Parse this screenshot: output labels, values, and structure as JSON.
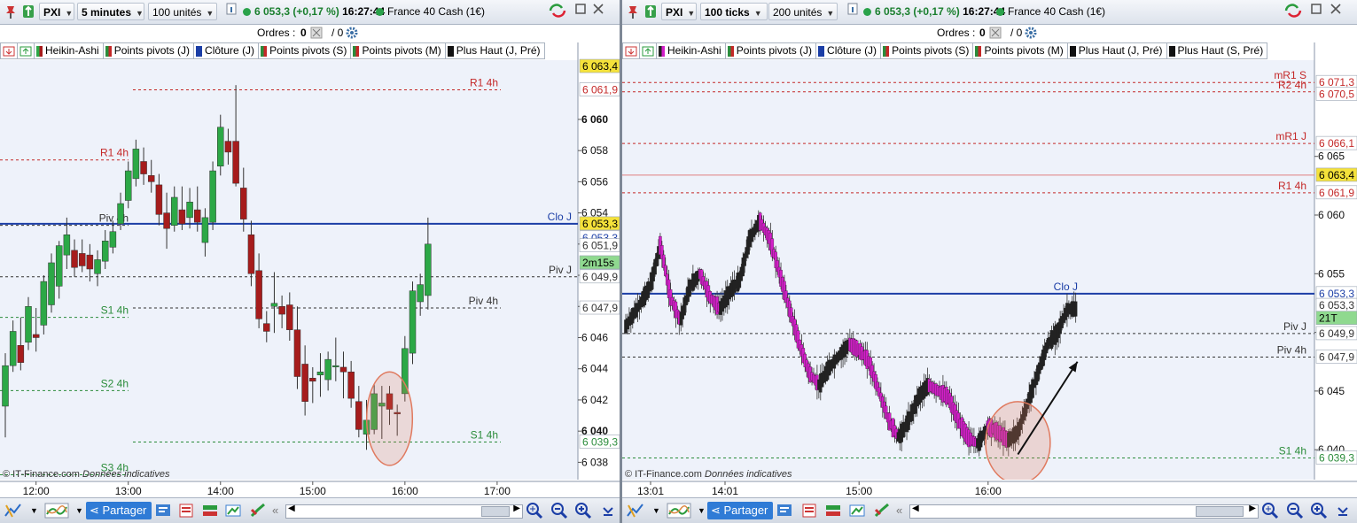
{
  "colors": {
    "bull": "#2ca846",
    "bear": "#a61c1c",
    "tick_up": "#222222",
    "tick_down": "#d21fc8",
    "clo_line": "#1b3ea6",
    "resistance": "#c42828",
    "support": "#2b8c3b",
    "pivot": "#333333",
    "highlight_ellipse": "#e07a5f"
  },
  "left": {
    "toolbar": {
      "ticker": "PXI",
      "interval": "5 minutes",
      "units": "100 unités",
      "price": "6 053,3",
      "change": "(+0,17 %)",
      "time": "16:27:44",
      "instrument": "France 40 Cash (1€)"
    },
    "orders": {
      "label": "Ordres :",
      "count": "0",
      "slash": "/ 0"
    },
    "indicators": [
      "Heikin-Ashi",
      "Points pivots (J)",
      "Clôture (J)",
      "Points pivots (S)",
      "Points pivots (M)",
      "Plus Haut (J, Pré)"
    ],
    "footer_note": "© IT-Finance.com",
    "footer_note2": "Données indicatives",
    "bottom": {
      "share": "Partager"
    },
    "chart_data": {
      "type": "candlestick",
      "title": "PXI France 40 Cash (1€) — 5 minutes, Heikin-Ashi",
      "y_ticks": [
        6038,
        6040,
        6042,
        6044,
        6046,
        6048,
        6050,
        6052,
        6054,
        6056,
        6058,
        6060
      ],
      "y_tick_labels": [
        "6 038",
        "6 040",
        "6 042",
        "6 044",
        "6 046",
        "6 048",
        "6 050",
        "6 052",
        "6 054",
        "6 056",
        "6 058",
        "6 060"
      ],
      "ylim": [
        6037,
        6063.8
      ],
      "x_ticks": [
        {
          "label": "12:00",
          "index": 4
        },
        {
          "label": "13:00",
          "index": 16
        },
        {
          "label": "14:00",
          "index": 28
        },
        {
          "label": "15:00",
          "index": 40
        },
        {
          "label": "16:00",
          "index": 52
        },
        {
          "label": "17:00",
          "index": 64
        }
      ],
      "candles": [
        [
          6041.6,
          6045.0,
          6039.6,
          6044.2
        ],
        [
          6044.2,
          6047.1,
          6043.8,
          6046.4
        ],
        [
          6045.5,
          6047.3,
          6043.9,
          6044.4
        ],
        [
          6045.7,
          6048.6,
          6045.2,
          6048.0
        ],
        [
          6046.2,
          6047.9,
          6045.1,
          6046.0
        ],
        [
          6046.8,
          6050.0,
          6046.2,
          6049.6
        ],
        [
          6048.1,
          6051.4,
          6047.6,
          6050.8
        ],
        [
          6049.3,
          6052.2,
          6048.5,
          6051.9
        ],
        [
          6051.3,
          6053.7,
          6050.4,
          6052.6
        ],
        [
          6051.6,
          6052.3,
          6049.9,
          6050.5
        ],
        [
          6051.4,
          6052.3,
          6050.2,
          6050.6
        ],
        [
          6051.3,
          6052.0,
          6049.6,
          6050.4
        ],
        [
          6050.1,
          6051.6,
          6049.3,
          6051.0
        ],
        [
          6050.9,
          6052.9,
          6050.4,
          6052.2
        ],
        [
          6051.8,
          6053.5,
          6051.4,
          6052.8
        ],
        [
          6053.3,
          6055.3,
          6052.9,
          6054.6
        ],
        [
          6054.8,
          6057.3,
          6054.3,
          6056.7
        ],
        [
          6056.2,
          6058.7,
          6055.7,
          6058.1
        ],
        [
          6057.3,
          6058.2,
          6055.8,
          6056.5
        ],
        [
          6056.4,
          6057.4,
          6055.3,
          6056.0
        ],
        [
          6055.8,
          6056.5,
          6053.2,
          6053.9
        ],
        [
          6054.0,
          6055.3,
          6051.7,
          6053.0
        ],
        [
          6053.2,
          6055.7,
          6052.8,
          6055.0
        ],
        [
          6054.2,
          6055.7,
          6052.9,
          6053.3
        ],
        [
          6053.7,
          6055.6,
          6053.0,
          6054.7
        ],
        [
          6054.2,
          6055.7,
          6052.8,
          6053.4
        ],
        [
          6052.1,
          6054.3,
          6051.2,
          6053.7
        ],
        [
          6053.4,
          6057.3,
          6052.9,
          6056.7
        ],
        [
          6057.0,
          6060.3,
          6056.4,
          6059.5
        ],
        [
          6058.6,
          6059.4,
          6057.1,
          6057.9
        ],
        [
          6058.6,
          6062.2,
          6055.7,
          6055.9
        ],
        [
          6055.6,
          6056.9,
          6052.8,
          6053.6
        ],
        [
          6052.6,
          6053.5,
          6049.3,
          6050.1
        ],
        [
          6050.3,
          6051.4,
          6046.6,
          6047.2
        ],
        [
          6046.9,
          6047.7,
          6045.7,
          6046.4
        ],
        [
          6048.0,
          6050.2,
          6046.3,
          6048.2
        ],
        [
          6048.0,
          6048.7,
          6046.6,
          6047.5
        ],
        [
          6048.1,
          6048.9,
          6045.8,
          6046.5
        ],
        [
          6046.5,
          6048.0,
          6042.7,
          6043.5
        ],
        [
          6044.3,
          6045.5,
          6041.0,
          6041.9
        ],
        [
          6043.4,
          6044.1,
          6041.8,
          6043.2
        ],
        [
          6043.6,
          6045.0,
          6042.2,
          6043.8
        ],
        [
          6043.3,
          6045.1,
          6042.6,
          6044.6
        ],
        [
          6044.2,
          6046.0,
          6043.2,
          6044.2
        ],
        [
          6044.1,
          6045.1,
          6042.1,
          6043.8
        ],
        [
          6043.8,
          6044.5,
          6041.5,
          6042.1
        ],
        [
          6041.9,
          6042.9,
          6039.6,
          6040.1
        ],
        [
          6039.8,
          6042.0,
          6038.8,
          6040.7
        ],
        [
          6040.1,
          6043.0,
          6039.8,
          6042.4
        ],
        [
          6041.6,
          6042.9,
          6039.5,
          6041.8
        ],
        [
          6042.4,
          6042.9,
          6040.4,
          6041.4
        ],
        [
          6041.2,
          6041.7,
          6039.7,
          6041.1
        ],
        [
          6042.4,
          6046.1,
          6041.9,
          6045.3
        ],
        [
          6045.0,
          6049.6,
          6044.3,
          6049.0
        ],
        [
          6048.3,
          6050.1,
          6047.4,
          6049.4
        ],
        [
          6048.7,
          6053.7,
          6047.8,
          6052.0
        ]
      ],
      "hlines": [
        {
          "label": "Clo J",
          "value": 6053.3,
          "kind": "clo"
        },
        {
          "label": "Piv J",
          "value": 6049.9,
          "kind": "pivot"
        },
        {
          "label": "Piv 4h",
          "value": 6047.9,
          "kind": "pivot"
        },
        {
          "label": "R1 4h",
          "value": 6061.9,
          "kind": "resistance"
        },
        {
          "label": "R1 4h",
          "value": 6057.4,
          "kind": "resistance"
        },
        {
          "label": "S1 4h",
          "value": 6047.3,
          "kind": "support"
        },
        {
          "label": "S2 4h",
          "value": 6042.6,
          "kind": "support"
        },
        {
          "label": "S1 4h",
          "value": 6039.3,
          "kind": "support"
        },
        {
          "label": "S3 4h",
          "value": 6037.2,
          "kind": "support"
        },
        {
          "label": "Piv 4h",
          "value": 6053.2,
          "kind": "pivot"
        }
      ],
      "price_labels": [
        {
          "text": "6 063,4",
          "value": 6063.4,
          "bg": "#f5e23a",
          "fg": "#000000"
        },
        {
          "text": "6 061,9",
          "value": 6061.9,
          "bg": "#ffffff",
          "fg": "#c42828"
        },
        {
          "text": "6 053,3",
          "value": 6053.3,
          "bg": "#f5e23a",
          "fg": "#000000"
        },
        {
          "text": "6 053,3",
          "value": 6052.4,
          "bg": "#ffffff",
          "fg": "#1b3ea6"
        },
        {
          "text": "6 051,9",
          "value": 6051.9,
          "bg": "#ffffff",
          "fg": "#333333"
        },
        {
          "text": "2m15s",
          "value": 6050.8,
          "bg": "#8fd98f",
          "fg": "#000000"
        },
        {
          "text": "6 049,9",
          "value": 6049.9,
          "bg": "#ffffff",
          "fg": "#333333"
        },
        {
          "text": "6 047,9",
          "value": 6047.9,
          "bg": "#ffffff",
          "fg": "#333333"
        },
        {
          "text": "6 039,3",
          "value": 6039.3,
          "bg": "#ffffff",
          "fg": "#2b8c3b"
        }
      ],
      "highlight": {
        "center_index": 50,
        "center_value": 6040.8,
        "index_radius": 2.4,
        "value_radius": 3.0
      }
    }
  },
  "right": {
    "toolbar": {
      "ticker": "PXI",
      "interval": "100 ticks",
      "units": "200 unités",
      "price": "6 053,3",
      "change": "(+0,17 %)",
      "time": "16:27:44",
      "instrument": "France 40 Cash (1€)"
    },
    "orders": {
      "label": "Ordres :",
      "count": "0",
      "slash": "/ 0"
    },
    "indicators": [
      "Heikin-Ashi",
      "Points pivots (J)",
      "Clôture (J)",
      "Points pivots (S)",
      "Points pivots (M)",
      "Plus Haut (J, Pré)",
      "Plus Haut (S, Pré)"
    ],
    "footer_note": "© IT-Finance.com",
    "footer_note2": "Données indicatives",
    "bottom": {
      "share": "Partager"
    },
    "chart_data": {
      "type": "candlestick",
      "title": "PXI France 40 Cash (1€) — 100 ticks, Heikin-Ashi",
      "y_ticks": [
        6040,
        6045,
        6050,
        6055,
        6060,
        6065
      ],
      "y_tick_labels": [
        "6 040",
        "6 045",
        "6 050",
        "6 055",
        "6 060",
        "6 065"
      ],
      "ylim": [
        6037.6,
        6073.2
      ],
      "x_ticks": [
        {
          "label": "13:01",
          "index": 5
        },
        {
          "label": "14:01",
          "index": 20
        },
        {
          "label": "15:00",
          "index": 47
        },
        {
          "label": "16:00",
          "index": 73
        }
      ],
      "hlines": [
        {
          "label": "mR1 S",
          "value": 6071.3,
          "kind": "resistance"
        },
        {
          "label": "R2 4h",
          "value": 6070.5,
          "kind": "resistance"
        },
        {
          "label": "mR1 J",
          "value": 6066.1,
          "kind": "resistance"
        },
        {
          "label": "R1 4h",
          "value": 6061.9,
          "kind": "resistance"
        },
        {
          "label": "",
          "value": 6063.4,
          "kind": "high"
        },
        {
          "label": "Clo J",
          "value": 6053.3,
          "kind": "clo"
        },
        {
          "label": "Piv J",
          "value": 6049.9,
          "kind": "pivot"
        },
        {
          "label": "Piv 4h",
          "value": 6047.9,
          "kind": "pivot"
        },
        {
          "label": "S1 4h",
          "value": 6039.3,
          "kind": "support"
        }
      ],
      "price_labels": [
        {
          "text": "6 071,3",
          "value": 6071.3,
          "bg": "#ffffff",
          "fg": "#c42828"
        },
        {
          "text": "6 070,5",
          "value": 6070.3,
          "bg": "#ffffff",
          "fg": "#c42828"
        },
        {
          "text": "6 066,1",
          "value": 6066.1,
          "bg": "#ffffff",
          "fg": "#c42828"
        },
        {
          "text": "6 063,4",
          "value": 6063.4,
          "bg": "#f5e23a",
          "fg": "#000000"
        },
        {
          "text": "6 061,9",
          "value": 6061.9,
          "bg": "#ffffff",
          "fg": "#c42828"
        },
        {
          "text": "6 053,3",
          "value": 6053.3,
          "bg": "#ffffff",
          "fg": "#1b3ea6"
        },
        {
          "text": "6 053,3",
          "value": 6052.3,
          "bg": "#ffffff",
          "fg": "#333333"
        },
        {
          "text": "21T",
          "value": 6051.2,
          "bg": "#8fd98f",
          "fg": "#000000"
        },
        {
          "text": "6 049,9",
          "value": 6049.9,
          "bg": "#ffffff",
          "fg": "#333333"
        },
        {
          "text": "6 047,9",
          "value": 6047.9,
          "bg": "#ffffff",
          "fg": "#333333"
        },
        {
          "text": "6 039,3",
          "value": 6039.3,
          "bg": "#ffffff",
          "fg": "#2b8c3b"
        }
      ],
      "series_path": [
        [
          0,
          6050.5
        ],
        [
          3,
          6052.5
        ],
        [
          5,
          6054
        ],
        [
          7,
          6057.5
        ],
        [
          9,
          6053
        ],
        [
          11,
          6051
        ],
        [
          13,
          6054
        ],
        [
          15,
          6055
        ],
        [
          17,
          6053
        ],
        [
          19,
          6052
        ],
        [
          21,
          6053.5
        ],
        [
          23,
          6054.5
        ],
        [
          25,
          6058
        ],
        [
          27,
          6059.5
        ],
        [
          29,
          6058
        ],
        [
          31,
          6055
        ],
        [
          33,
          6052
        ],
        [
          35,
          6049
        ],
        [
          37,
          6046.5
        ],
        [
          39,
          6045.5
        ],
        [
          41,
          6047
        ],
        [
          43,
          6048
        ],
        [
          45,
          6049
        ],
        [
          47,
          6048.5
        ],
        [
          49,
          6047.5
        ],
        [
          51,
          6045
        ],
        [
          53,
          6042.5
        ],
        [
          55,
          6041
        ],
        [
          57,
          6042.5
        ],
        [
          59,
          6044.5
        ],
        [
          61,
          6045.5
        ],
        [
          63,
          6045
        ],
        [
          65,
          6044.5
        ],
        [
          67,
          6042.5
        ],
        [
          69,
          6041
        ],
        [
          71,
          6040.5
        ],
        [
          73,
          6042
        ],
        [
          75,
          6041.5
        ],
        [
          77,
          6040.8
        ],
        [
          79,
          6041.5
        ],
        [
          81,
          6044
        ],
        [
          83,
          6046.5
        ],
        [
          85,
          6049
        ],
        [
          87,
          6050
        ],
        [
          89,
          6052
        ]
      ],
      "highlight": {
        "center_index": 79,
        "center_value": 6040.6,
        "index_radius": 3.3,
        "value_radius": 3.5
      },
      "arrow": {
        "from_index": 79,
        "from_value": 6039.6,
        "to_index": 91,
        "to_value": 6047.5
      }
    }
  }
}
